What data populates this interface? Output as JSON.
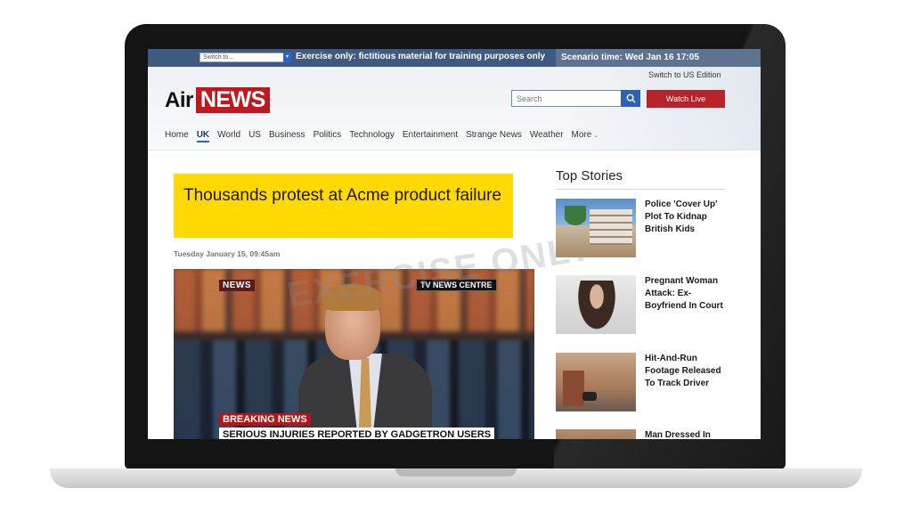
{
  "exercise_bar": {
    "switch_placeholder": "Switch to...",
    "notice": "Exercise only: fictitious material for training purposes only",
    "scenario_time": "Scenario time: Wed Jan 16 17:05"
  },
  "header": {
    "edition_link": "Switch to US Edition",
    "logo_word": "Air",
    "logo_badge": "NEWS",
    "search_placeholder": "Search",
    "watch_live": "Watch Live"
  },
  "nav": {
    "items": [
      "Home",
      "UK",
      "World",
      "US",
      "Business",
      "Politics",
      "Technology",
      "Entertainment",
      "Strange News",
      "Weather",
      "More"
    ],
    "active": "UK"
  },
  "article": {
    "headline": "Thousands protest at Acme product failure",
    "dateline": "Tuesday January 15, 09:45am",
    "watermark": "EXERCISE ONLY",
    "video": {
      "news_badge": "NEWS",
      "centre_badge": "TV NEWS CENTRE",
      "breaking_label": "BREAKING NEWS",
      "ticker": "SERIOUS INJURIES REPORTED BY GADGETRON USERS"
    }
  },
  "top_stories": {
    "title": "Top Stories",
    "items": [
      {
        "title": "Police 'Cover Up' Plot To Kidnap British Kids"
      },
      {
        "title": "Pregnant Woman Attack: Ex-Boyfriend In Court"
      },
      {
        "title": "Hit-And-Run Footage Released To Track Driver"
      },
      {
        "title": "Man Dressed In"
      }
    ]
  },
  "colors": {
    "exercise_bar": "#3f5a80",
    "brand_red": "#c0181f",
    "headline_yellow": "#ffd900",
    "link_blue": "#2b62b6"
  }
}
